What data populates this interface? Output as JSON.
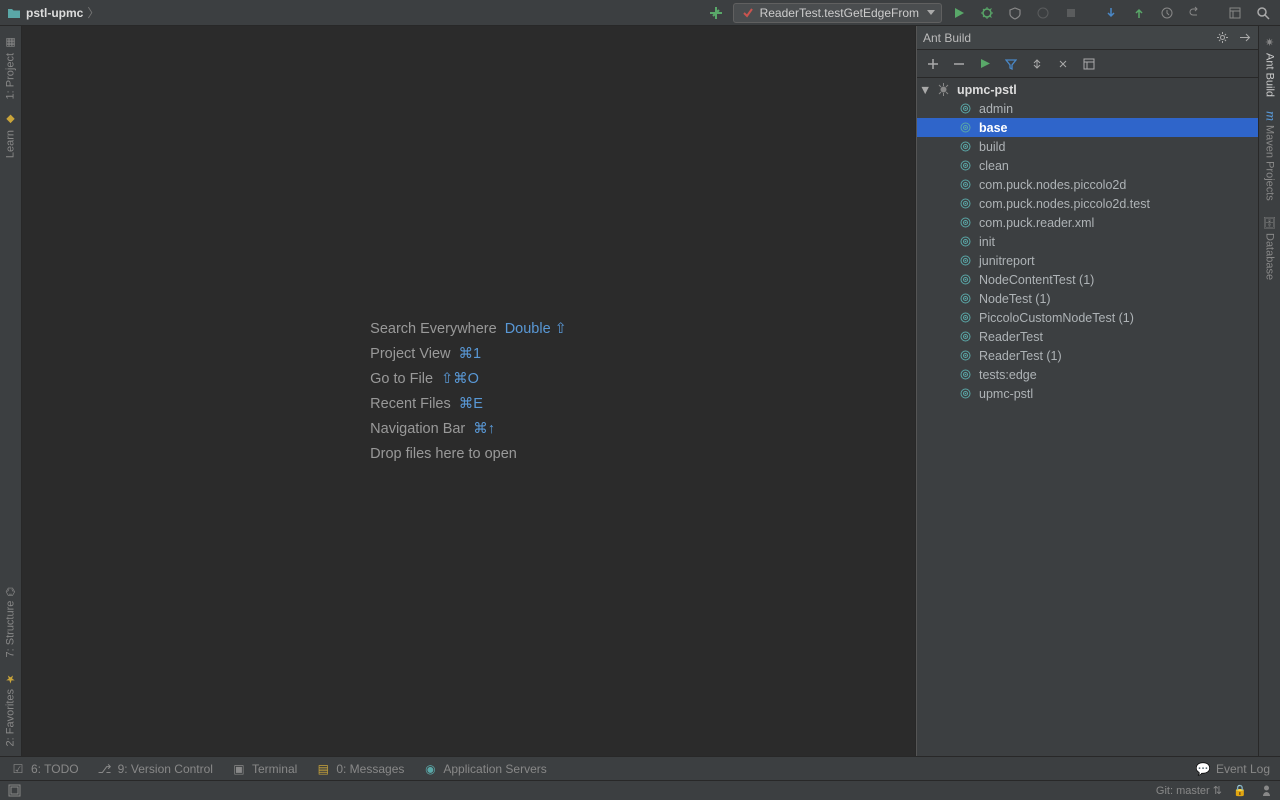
{
  "nav": {
    "project": "pstl-upmc"
  },
  "run": {
    "config": "ReaderTest.testGetEdgeFrom"
  },
  "editor_hints": [
    {
      "label": "Search Everywhere",
      "key": "Double ⇧"
    },
    {
      "label": "Project View",
      "key": "⌘1"
    },
    {
      "label": "Go to File",
      "key": "⇧⌘O"
    },
    {
      "label": "Recent Files",
      "key": "⌘E"
    },
    {
      "label": "Navigation Bar",
      "key": "⌘↑"
    },
    {
      "label": "Drop files here to open",
      "key": ""
    }
  ],
  "ant": {
    "title": "Ant Build",
    "root": "upmc-pstl",
    "targets": [
      "admin",
      "base",
      "build",
      "clean",
      "com.puck.nodes.piccolo2d",
      "com.puck.nodes.piccolo2d.test",
      "com.puck.reader.xml",
      "init",
      "junitreport",
      "NodeContentTest (1)",
      "NodeTest (1)",
      "PiccoloCustomNodeTest (1)",
      "ReaderTest",
      "ReaderTest (1)",
      "tests:edge",
      "upmc-pstl"
    ],
    "selected": "base"
  },
  "left_tabs": {
    "project": "1: Project",
    "learn": "Learn",
    "structure": "7: Structure",
    "favorites": "2: Favorites"
  },
  "right_tabs": {
    "ant": "Ant Build",
    "maven": "Maven Projects",
    "database": "Database"
  },
  "bottom": {
    "todo": "6: TODO",
    "vcs": "9: Version Control",
    "terminal": "Terminal",
    "messages": "0: Messages",
    "appservers": "Application Servers",
    "eventlog": "Event Log"
  },
  "status": {
    "git": "Git: master"
  }
}
